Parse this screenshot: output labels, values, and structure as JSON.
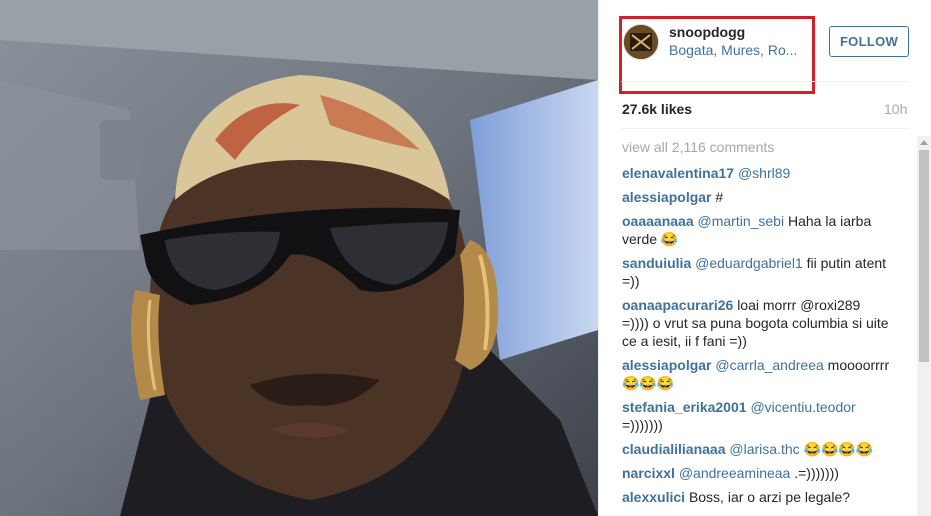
{
  "post": {
    "username": "snoopdogg",
    "location": "Bogata, Mures, Ro...",
    "follow_label": "FOLLOW",
    "likes": "27.6k likes",
    "time": "10h",
    "view_all": "view all 2,116 comments"
  },
  "comments": [
    {
      "user": "elenavalentina17",
      "mention": "@shrl89",
      "text": ""
    },
    {
      "user": "alessiapolgar",
      "mention": "",
      "text": "#"
    },
    {
      "user": "oaaaanaaa",
      "mention": "@martin_sebi",
      "text": "Haha la iarba verde 😂"
    },
    {
      "user": "sanduiulia",
      "mention": "@eduardgabriel1",
      "text": "fii putin atent =))"
    },
    {
      "user": "oanaapacurari26",
      "mention": "",
      "text": "loai morrr @roxi289 =)))) o vrut sa puna bogota columbia si uite ce a iesit, ii f fani =))"
    },
    {
      "user": "alessiapolgar",
      "mention": "@carrla_andreea",
      "text": "moooorrrr😂😂😂"
    },
    {
      "user": "stefania_erika2001",
      "mention": "@vicentiu.teodor",
      "text": "=)))))))"
    },
    {
      "user": "claudialilianaaa",
      "mention": "@larisa.thc",
      "text": "😂😂😂😂"
    },
    {
      "user": "narcixxl",
      "mention": "@andreeamineaa",
      "text": ".=)))))))"
    },
    {
      "user": "alexxulici",
      "mention": "",
      "text": "Boss, iar o arzi pe legale?"
    }
  ],
  "colors": {
    "link": "#3f729b",
    "annotation": "#d0202a",
    "muted": "#a5a7aa"
  }
}
